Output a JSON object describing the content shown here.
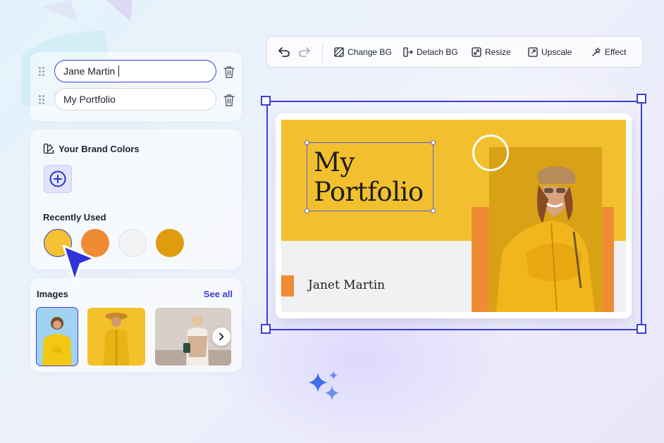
{
  "name_fields": [
    {
      "value": "Jane Martin",
      "active": true
    },
    {
      "value": "My Portfolio",
      "active": false
    }
  ],
  "brand": {
    "title": "Your Brand Colors",
    "icon": "palette-icon",
    "add_icon": "plus-circle-icon",
    "recent_label": "Recently Used",
    "swatches": [
      "#f4c232",
      "#ef8b32",
      "#f3f3f5",
      "#df9c0d"
    ],
    "selected_swatch": 0
  },
  "images": {
    "label": "Images",
    "see_all": "See all",
    "next_icon": "chevron-right-icon"
  },
  "toolbar": {
    "undo_icon": "undo-icon",
    "redo_icon": "redo-icon",
    "items": [
      {
        "label": "Change BG",
        "icon": "change-bg-icon"
      },
      {
        "label": "Detach BG",
        "icon": "detach-bg-icon"
      },
      {
        "label": "Resize",
        "icon": "resize-icon"
      },
      {
        "label": "Upscale",
        "icon": "upscale-icon"
      },
      {
        "label": "Effect",
        "icon": "magic-wand-icon"
      }
    ]
  },
  "canvas": {
    "title_line1": "My",
    "title_line2": "Portfolio",
    "subtitle": "Janet Martin"
  },
  "colors": {
    "accent": "#3b3fd8",
    "yellow": "#f2c02f",
    "orange": "#ef8b32",
    "mustard": "#d9a116"
  }
}
